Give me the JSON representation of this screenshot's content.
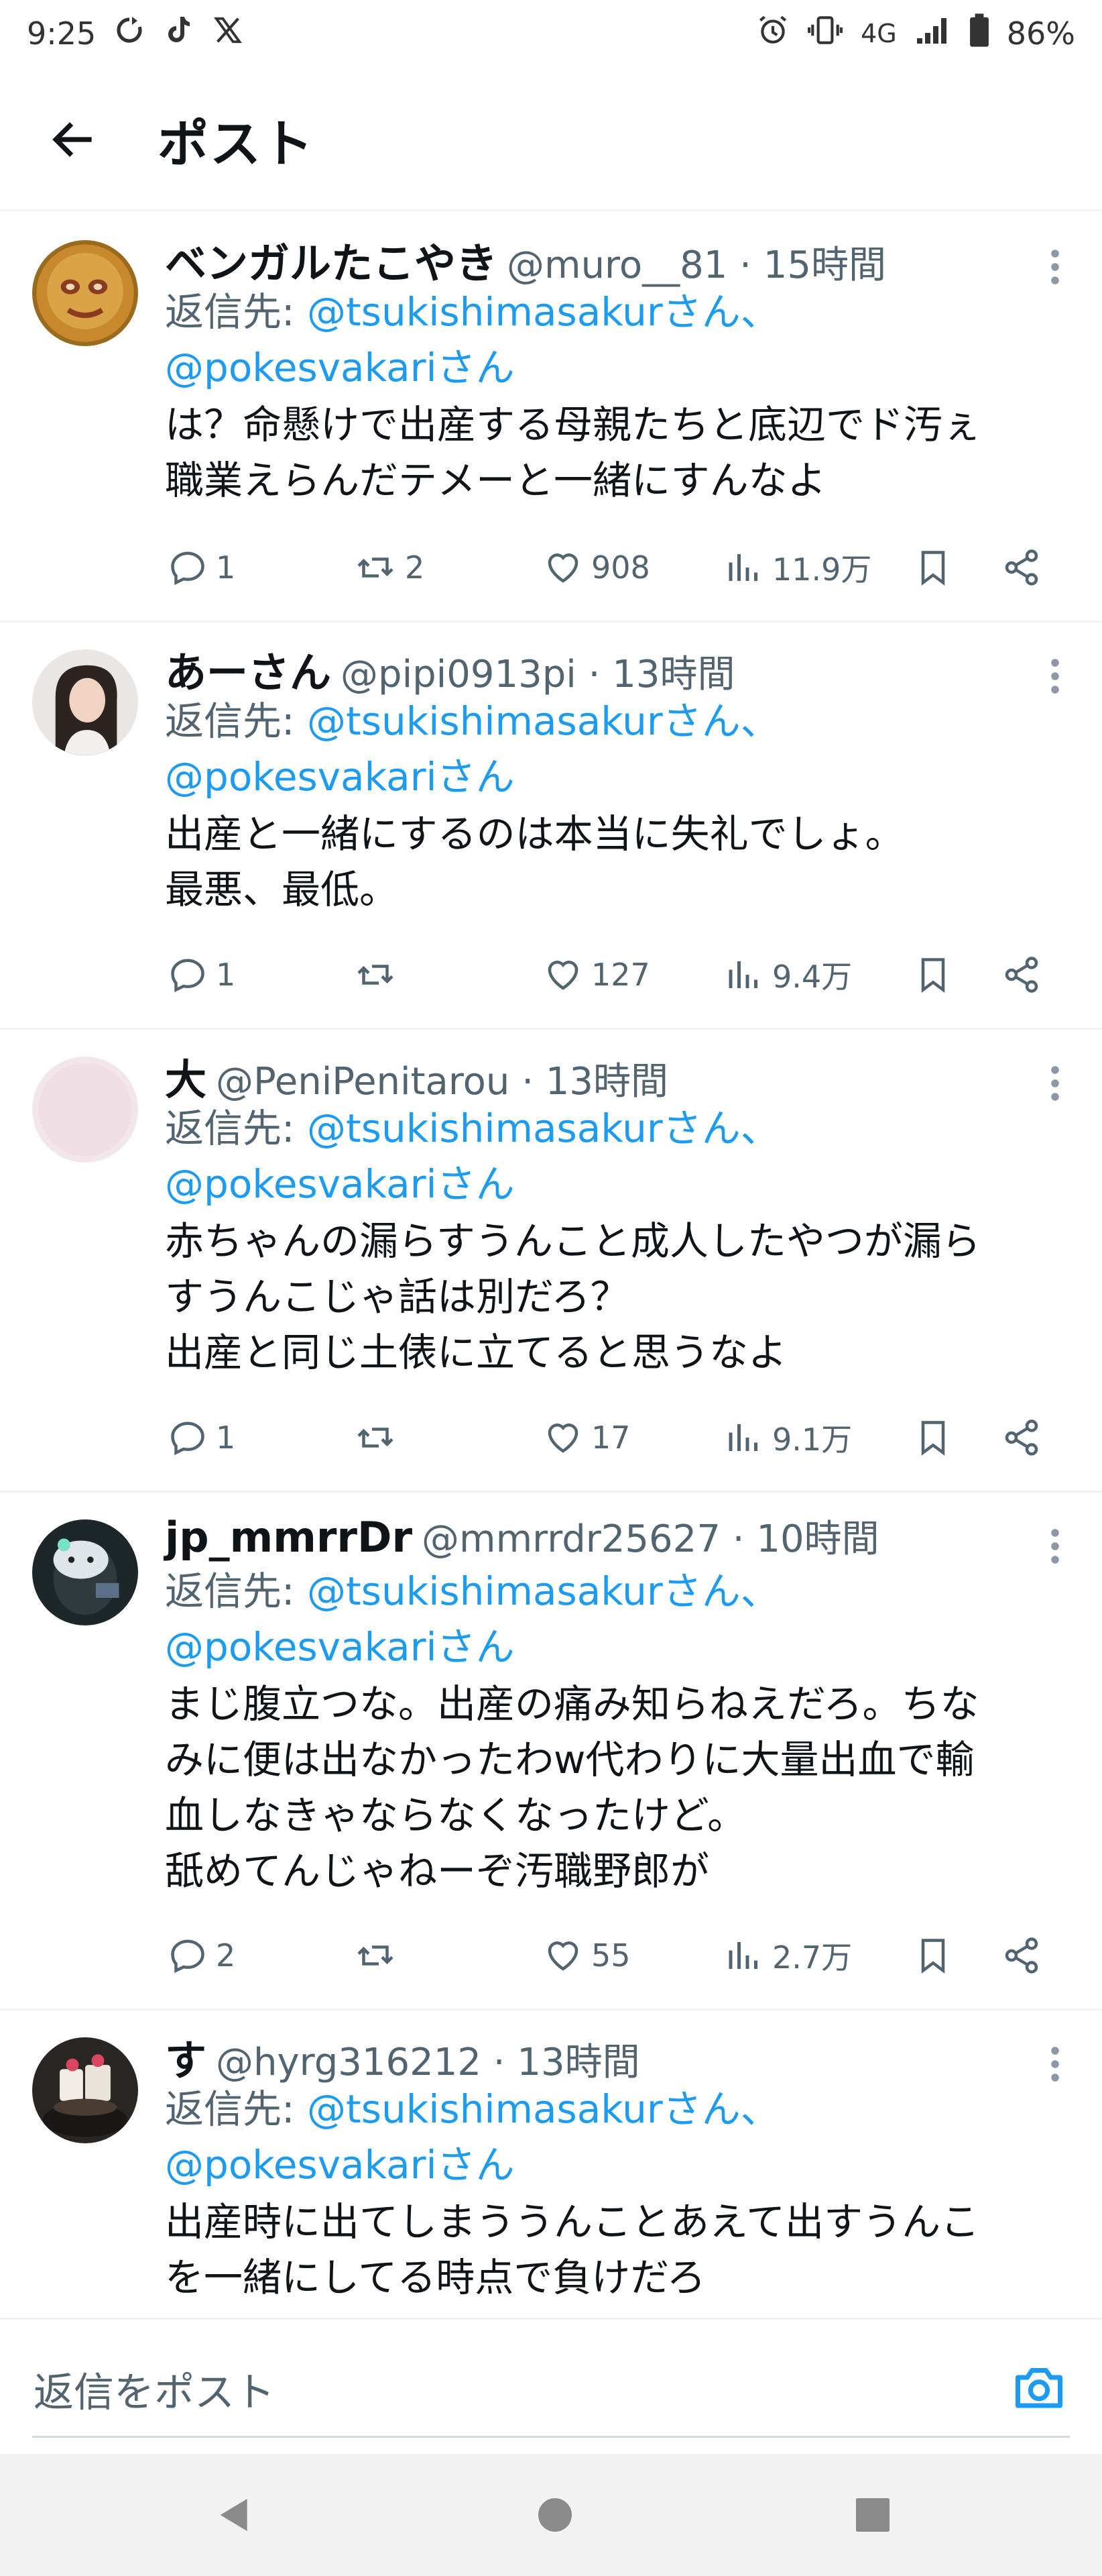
{
  "status_bar": {
    "time": "9:25",
    "network": "4G",
    "battery": "86%"
  },
  "header": {
    "title": "ポスト"
  },
  "reply_prefix": "返信先: ",
  "tweets": [
    {
      "display_name": "ベンガルたこやき",
      "handle": "@muro__81 · 15時間",
      "reply_mentions": [
        "@tsukishimasakurさん、",
        "@pokesvakariさん"
      ],
      "text_lines": [
        "は？命懸けで出産する母親たちと底辺でド汚ぇ",
        "職業えらんだテメーと一緒にすんなよ"
      ],
      "replies": "1",
      "reposts": "2",
      "likes": "908",
      "views": "11.9万"
    },
    {
      "display_name": "あーさん",
      "handle": "@pipi0913pi · 13時間",
      "reply_mentions": [
        "@tsukishimasakurさん、",
        "@pokesvakariさん"
      ],
      "text_lines": [
        "出産と一緒にするのは本当に失礼でしょ。",
        "最悪、最低。"
      ],
      "replies": "1",
      "reposts": "",
      "likes": "127",
      "views": "9.4万"
    },
    {
      "display_name": "大",
      "handle": "@PeniPenitarou · 13時間",
      "reply_mentions": [
        "@tsukishimasakurさん、",
        "@pokesvakariさん"
      ],
      "text_lines": [
        "赤ちゃんの漏らすうんこと成人したやつが漏ら",
        "すうんこじゃ話は別だろ？",
        "出産と同じ土俵に立てると思うなよ"
      ],
      "replies": "1",
      "reposts": "",
      "likes": "17",
      "views": "9.1万"
    },
    {
      "display_name": "jp_mmrrDr",
      "handle": "@mmrrdr25627 · 10時間",
      "reply_mentions": [
        "@tsukishimasakurさん、",
        "@pokesvakariさん"
      ],
      "text_lines": [
        "まじ腹立つな。出産の痛み知らねえだろ。ちな",
        "みに便は出なかったわw代わりに大量出血で輸",
        "血しなきゃならなくなったけど。",
        "舐めてんじゃねーぞ汚職野郎が"
      ],
      "replies": "2",
      "reposts": "",
      "likes": "55",
      "views": "2.7万"
    },
    {
      "display_name": "す",
      "handle": "@hyrg316212 · 13時間",
      "reply_mentions": [
        "@tsukishimasakurさん、",
        "@pokesvakariさん"
      ],
      "text_lines": [
        "出産時に出てしまううんことあえて出すうんこ",
        "を一緒にしてる時点で負けだろ"
      ],
      "replies": "",
      "reposts": "",
      "likes": "",
      "views": ""
    }
  ],
  "reply_bar": {
    "placeholder": "返信をポスト"
  },
  "colors": {
    "accent": "#1d9bf0",
    "text": "#0f1419",
    "secondary": "#536471",
    "divider": "#eff3f4"
  }
}
